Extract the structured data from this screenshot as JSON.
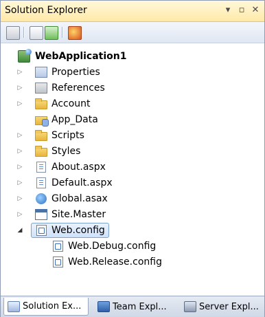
{
  "titlebar": {
    "title": "Solution Explorer",
    "dropdown_icon": "dropdown-arrow-icon",
    "pin_icon": "pin-icon",
    "close_icon": "close-icon"
  },
  "toolbar": {
    "buttons": [
      "properties-icon",
      "show-all-files-icon",
      "refresh-icon",
      "copy-website-icon"
    ]
  },
  "tree": {
    "root": "WebApplication1",
    "items": [
      {
        "label": "Properties",
        "icon": "properties-icon",
        "expander": "▷"
      },
      {
        "label": "References",
        "icon": "references-icon",
        "expander": "▷"
      },
      {
        "label": "Account",
        "icon": "folder-icon",
        "expander": "▷"
      },
      {
        "label": "App_Data",
        "icon": "app-data-folder-icon",
        "expander": ""
      },
      {
        "label": "Scripts",
        "icon": "folder-icon",
        "expander": "▷"
      },
      {
        "label": "Styles",
        "icon": "folder-icon",
        "expander": "▷"
      },
      {
        "label": "About.aspx",
        "icon": "aspx-page-icon",
        "expander": "▷"
      },
      {
        "label": "Default.aspx",
        "icon": "aspx-page-icon",
        "expander": "▷"
      },
      {
        "label": "Global.asax",
        "icon": "global-asax-icon",
        "expander": "▷"
      },
      {
        "label": "Site.Master",
        "icon": "master-page-icon",
        "expander": "▷"
      },
      {
        "label": "Web.config",
        "icon": "config-file-icon",
        "expander": "◢",
        "selected": true
      },
      {
        "label": "Web.Debug.config",
        "icon": "config-file-icon",
        "expander": ""
      },
      {
        "label": "Web.Release.config",
        "icon": "config-file-icon",
        "expander": ""
      }
    ]
  },
  "tabs": [
    {
      "label": "Solution Ex...",
      "icon": "solution-explorer-icon",
      "active": true
    },
    {
      "label": "Team Expl...",
      "icon": "team-explorer-icon",
      "active": false
    },
    {
      "label": "Server Expl...",
      "icon": "server-explorer-icon",
      "active": false
    }
  ]
}
